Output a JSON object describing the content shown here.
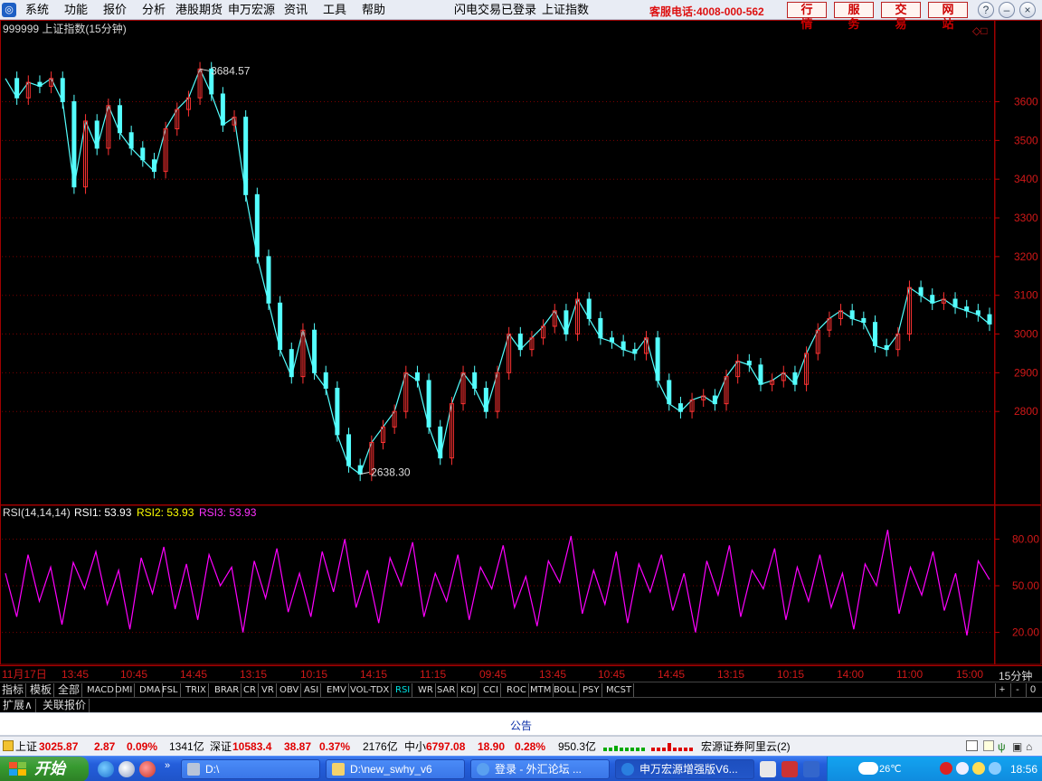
{
  "menubar": {
    "items": [
      "系统",
      "功能",
      "报价",
      "分析",
      "港股期货",
      "申万宏源",
      "资讯",
      "工具",
      "帮助"
    ],
    "status": "闪电交易已登录",
    "index_name": "上证指数",
    "hotline": "客服电话:4008-000-562",
    "buttons": [
      "行情",
      "服务",
      "交易",
      "网站"
    ]
  },
  "chart_header": {
    "code_title": "999999 上证指数(15分钟)",
    "high_marker": "3684.57",
    "low_marker": "2638.30"
  },
  "rsi_header": {
    "params": "RSI(14,14,14)",
    "rsi1_label": "RSI1: 53.93",
    "rsi2_label": "RSI2: 53.93",
    "rsi3_label": "RSI3: 53.93",
    "colors": {
      "rsi1": "#ffffff",
      "rsi2": "#ffff00",
      "rsi3": "#ff00ff"
    }
  },
  "time_axis": {
    "labels": [
      "11月17日",
      "13:45",
      "10:45",
      "14:45",
      "13:15",
      "10:15",
      "14:15",
      "11:15",
      "09:45",
      "13:45",
      "10:45",
      "14:45",
      "13:15",
      "10:15",
      "14:00",
      "11:00",
      "15:00"
    ],
    "period": "15分钟"
  },
  "indicator_tabs": [
    "指标",
    "模板",
    "全部",
    "MACD",
    "DMI",
    "DMA",
    "FSL",
    "TRIX",
    "BRAR",
    "CR",
    "VR",
    "OBV",
    "ASI",
    "EMV",
    "VOL-TDX",
    "RSI",
    "WR",
    "SAR",
    "KDJ",
    "CCI",
    "ROC",
    "MTM",
    "BOLL",
    "PSY",
    "MCST"
  ],
  "active_tab": "RSI",
  "tab_controls": [
    "+",
    "-",
    "0"
  ],
  "sub_tabs": [
    "扩展∧",
    "关联报价"
  ],
  "announcement": "公告",
  "statusbar": {
    "sh_label": "上证",
    "sh_value": "3025.87",
    "sh_change": "2.87",
    "sh_pct": "0.09%",
    "sh_vol": "1341亿",
    "sz_label": "深证",
    "sz_value": "10583.4",
    "sz_change": "38.87",
    "sz_pct": "0.37%",
    "sz_vol": "2176亿",
    "sme_label": "中小",
    "sme_value": "6797.08",
    "sme_change": "18.90",
    "sme_pct": "0.28%",
    "sme_vol": "950.3亿",
    "server": "宏源证券阿里云(2)"
  },
  "taskbar": {
    "start": "开始",
    "buttons": [
      "D:\\",
      "D:\\new_swhy_v6",
      "登录 - 外汇论坛 ...",
      "申万宏源增强版V6..."
    ],
    "temperature": "26℃",
    "clock": "18:56"
  },
  "icons": {
    "app": "app-logo-icon",
    "minimize": "minimize-icon",
    "restore": "restore-icon",
    "close": "close-icon"
  },
  "chart_data": [
    {
      "type": "line",
      "title": "999999 上证指数(15分钟)",
      "ylim": [
        2560,
        3760
      ],
      "yticks": [
        2800,
        2900,
        3000,
        3100,
        3200,
        3300,
        3400,
        3500,
        3600
      ],
      "annotations": [
        {
          "text": "3684.57",
          "value": 3684.57
        },
        {
          "text": "2638.30",
          "value": 2638.3
        }
      ],
      "series": [
        {
          "values": [
            3660,
            3610,
            3650,
            3640,
            3660,
            3600,
            3380,
            3550,
            3480,
            3590,
            3520,
            3480,
            3450,
            3420,
            3530,
            3580,
            3610,
            3684.57,
            3620,
            3540,
            3560,
            3360,
            3200,
            3080,
            2960,
            2890,
            3010,
            2900,
            2860,
            2740,
            2660,
            2638.3,
            2720,
            2760,
            2800,
            2900,
            2880,
            2760,
            2680,
            2820,
            2900,
            2860,
            2800,
            2900,
            3000,
            2960,
            2990,
            3020,
            3060,
            3000,
            3090,
            3040,
            2990,
            2980,
            2960,
            2950,
            2990,
            2880,
            2820,
            2800,
            2830,
            2840,
            2820,
            2890,
            2930,
            2920,
            2870,
            2880,
            2900,
            2870,
            2950,
            3010,
            3040,
            3060,
            3040,
            3030,
            2970,
            2960,
            3000,
            3120,
            3100,
            3080,
            3090,
            3070,
            3060,
            3050,
            3025.87
          ]
        }
      ]
    },
    {
      "type": "line",
      "title": "RSI(14,14,14)",
      "ylim": [
        0,
        100
      ],
      "yticks": [
        20,
        50,
        80
      ],
      "series": [
        {
          "name": "RSI3",
          "values": [
            58,
            30,
            70,
            40,
            62,
            25,
            65,
            48,
            72,
            38,
            60,
            22,
            68,
            45,
            75,
            35,
            64,
            28,
            70,
            50,
            62,
            20,
            66,
            42,
            74,
            33,
            58,
            30,
            72,
            46,
            80,
            36,
            60,
            26,
            68,
            50,
            78,
            30,
            58,
            40,
            70,
            28,
            62,
            48,
            76,
            36,
            56,
            24,
            66,
            52,
            82,
            32,
            60,
            38,
            72,
            26,
            64,
            46,
            70,
            34,
            58,
            20,
            66,
            44,
            76,
            30,
            60,
            48,
            74,
            28,
            62,
            40,
            70,
            36,
            58,
            22,
            64,
            50,
            86,
            32,
            62,
            44,
            72,
            34,
            58,
            18,
            66,
            53.93
          ]
        }
      ]
    }
  ]
}
